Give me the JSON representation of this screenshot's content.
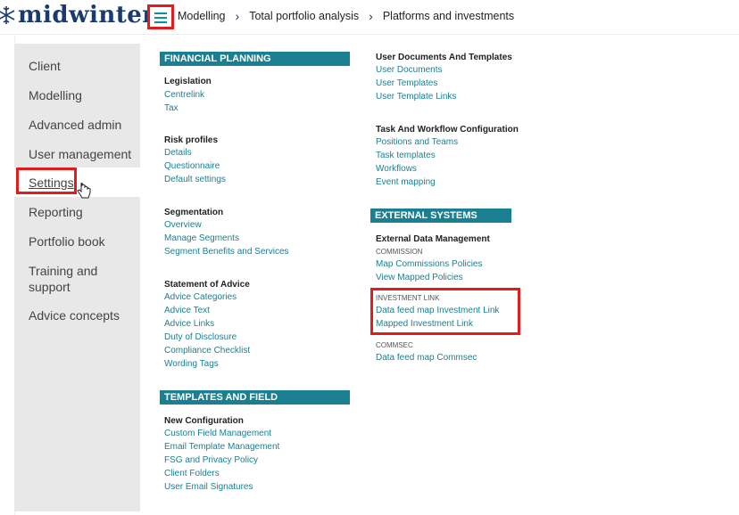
{
  "brand": {
    "name": "midwinter"
  },
  "breadcrumb": [
    "Modelling",
    "Total portfolio analysis",
    "Platforms and investments"
  ],
  "left_menu": {
    "items": [
      "Client",
      "Modelling",
      "Advanced admin",
      "User management",
      "Settings",
      "Reporting",
      "Portfolio book",
      "Training and support",
      "Advice concepts"
    ],
    "active": "Settings"
  },
  "sections": {
    "financial_planning": "FINANCIAL PLANNING CONFIGURATIONS",
    "templates": "TEMPLATES AND FIELD MANAGEMENT",
    "external": "EXTERNAL SYSTEMS"
  },
  "groups": {
    "legislation": {
      "title": "Legislation",
      "links": [
        "Centrelink",
        "Tax"
      ]
    },
    "risk_profiles": {
      "title": "Risk profiles",
      "links": [
        "Details",
        "Questionnaire",
        "Default settings"
      ]
    },
    "segmentation": {
      "title": "Segmentation",
      "links": [
        "Overview",
        "Manage Segments",
        "Segment Benefits and Services"
      ]
    },
    "statement": {
      "title": "Statement of Advice",
      "links": [
        "Advice Categories",
        "Advice Text",
        "Advice Links",
        "Duty of Disclosure",
        "Compliance Checklist",
        "Wording Tags"
      ]
    },
    "new_config": {
      "title": "New Configuration",
      "links": [
        "Custom Field Management",
        "Email Template Management",
        "FSG and Privacy Policy",
        "Client Folders",
        "User Email Signatures"
      ]
    },
    "user_docs": {
      "title": "User Documents And Templates",
      "links": [
        "User Documents",
        "User Templates",
        "User Template Links"
      ]
    },
    "task_workflow": {
      "title": "Task And Workflow Configuration",
      "links": [
        "Positions and Teams",
        "Task templates",
        "Workflows",
        "Event mapping"
      ]
    },
    "external_data": {
      "title": "External Data Management",
      "commission_caption": "COMMISSION",
      "commission_links": [
        "Map Commissions Policies",
        "View Mapped Policies"
      ],
      "investment_caption": "INVESTMENT LINK",
      "investment_links": [
        "Data feed map Investment Link",
        "Mapped Investment Link"
      ],
      "commsec_caption": "COMMSEC",
      "commsec_links": [
        "Data feed map Commsec"
      ]
    }
  },
  "colors": {
    "accent": "#1a7f91",
    "brand": "#1a3b6e",
    "highlight": "#e21b1b"
  }
}
